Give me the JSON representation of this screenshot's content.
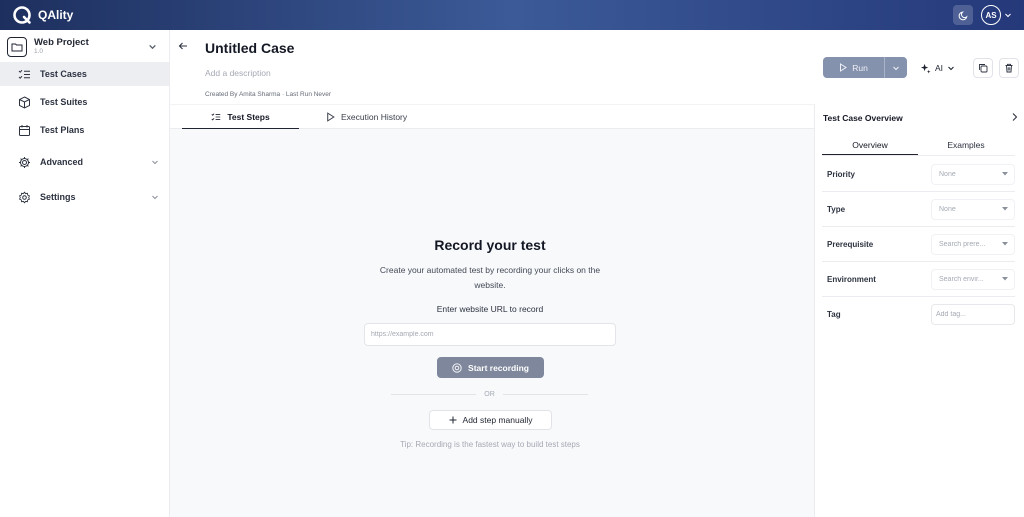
{
  "app": {
    "name": "QAlity",
    "user_initials": "AS"
  },
  "sidebar": {
    "project": {
      "name": "Web Project",
      "version": "1.0"
    },
    "items": [
      {
        "label": "Test Cases",
        "icon": "list-check-icon",
        "active": true
      },
      {
        "label": "Test Suites",
        "icon": "cube-icon"
      },
      {
        "label": "Test Plans",
        "icon": "calendar-icon"
      },
      {
        "label": "Advanced",
        "icon": "gear-icon",
        "expandable": true
      },
      {
        "label": "Settings",
        "icon": "cog-icon",
        "expandable": true
      }
    ]
  },
  "header": {
    "title": "Untitled Case",
    "description_placeholder": "Add a description",
    "meta": "Created By Amita Sharma  ·  Last Run Never",
    "run_label": "Run",
    "ai_label": "AI"
  },
  "tabs": [
    {
      "label": "Test Steps",
      "active": true
    },
    {
      "label": "Execution History"
    }
  ],
  "recorder": {
    "title": "Record your test",
    "subtitle": "Create your automated test by recording your clicks on the website.",
    "url_label": "Enter website URL to record",
    "url_placeholder": "https://example.com",
    "start_label": "Start recording",
    "or_label": "OR",
    "manual_label": "Add step manually",
    "tip": "Tip: Recording is the fastest way to build test steps"
  },
  "panel": {
    "title": "Test Case Overview",
    "tabs": [
      {
        "label": "Overview",
        "active": true
      },
      {
        "label": "Examples"
      }
    ],
    "fields": [
      {
        "label": "Priority",
        "value": "None"
      },
      {
        "label": "Type",
        "value": "None"
      },
      {
        "label": "Prerequisite",
        "value": "Search prere..."
      },
      {
        "label": "Environment",
        "value": "Search envir..."
      },
      {
        "label": "Tag",
        "value": "Add tag..."
      }
    ]
  },
  "colors": {
    "topbar": "#2c4580",
    "run_button": "#8592ad",
    "start_button": "#7e879c"
  }
}
